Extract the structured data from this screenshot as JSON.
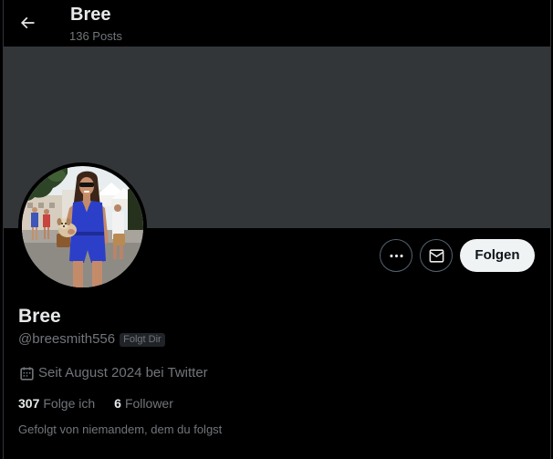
{
  "colors": {
    "background": "#000000",
    "banner": "#333639",
    "text_primary": "#e7e9ea",
    "text_secondary": "#71767b",
    "border": "#2f3336",
    "follow_button": "#eff3f4"
  },
  "header": {
    "back_icon": "arrow-left-icon",
    "title": "Bree",
    "subtitle": "136 Posts"
  },
  "actions": {
    "more_icon": "more-horizontal-icon",
    "message_icon": "mail-icon",
    "follow_label": "Folgen"
  },
  "profile": {
    "name": "Bree",
    "handle": "@breesmith556",
    "follows_you_badge": "Folgt Dir",
    "joined_icon": "calendar-icon",
    "joined": "Seit August 2024 bei Twitter",
    "stats": [
      {
        "count": "307",
        "label": "Folge ich"
      },
      {
        "count": "6",
        "label": "Follower"
      }
    ],
    "followed_by": "Gefolgt von niemandem, dem du folgst"
  }
}
